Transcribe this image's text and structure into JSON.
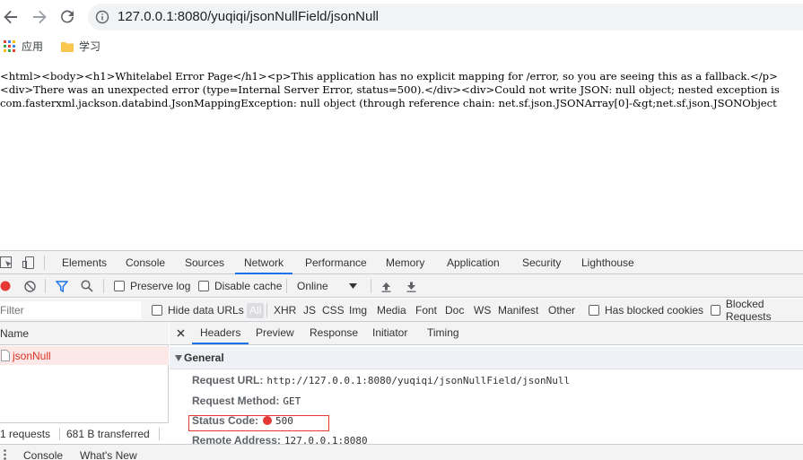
{
  "browser": {
    "url": "127.0.0.1:8080/yuqiqi/jsonNullField/jsonNull",
    "bookmarks": [
      {
        "label": "应用",
        "icon": "apps-grid-icon"
      },
      {
        "label": "学习",
        "icon": "folder-icon"
      }
    ]
  },
  "page": {
    "lines": [
      "<html><body><h1>Whitelabel Error Page</h1><p>This application has no explicit mapping for /error, so you are seeing this as a fallback.</p>",
      "<div>There was an unexpected error (type=Internal Server Error, status=500).</div><div>Could not write JSON: null object; nested exception is",
      "com.fasterxml.jackson.databind.JsonMappingException: null object (through reference chain: net.sf.json.JSONArray[0]-&gt;net.sf.json.JSONObject"
    ]
  },
  "devtools": {
    "tabs": [
      "Elements",
      "Console",
      "Sources",
      "Network",
      "Performance",
      "Memory",
      "Application",
      "Security",
      "Lighthouse"
    ],
    "active_tab": "Network",
    "network_toolbar": {
      "preserve_log": "Preserve log",
      "disable_cache": "Disable cache",
      "throttle": "Online"
    },
    "filter": {
      "placeholder": "Filter",
      "hide_data_urls": "Hide data URLs",
      "types": [
        "All",
        "XHR",
        "JS",
        "CSS",
        "Img",
        "Media",
        "Font",
        "Doc",
        "WS",
        "Manifest",
        "Other"
      ],
      "has_blocked_cookies": "Has blocked cookies",
      "blocked_requests": "Blocked Requests"
    },
    "request_list": {
      "column_name": "Name",
      "rows": [
        {
          "name": "jsonNull",
          "status": "error"
        }
      ],
      "summary_requests": "1 requests",
      "summary_transferred": "681 B transferred"
    },
    "details": {
      "tabs": [
        "Headers",
        "Preview",
        "Response",
        "Initiator",
        "Timing"
      ],
      "active_tab": "Headers",
      "section_title": "General",
      "request_url_key": "Request URL:",
      "request_url": "http://127.0.0.1:8080/yuqiqi/jsonNullField/jsonNull",
      "request_method_key": "Request Method:",
      "request_method": "GET",
      "status_code_key": "Status Code:",
      "status_code": "500",
      "remote_address_key": "Remote Address:",
      "remote_address": "127.0.0.1:8080"
    },
    "drawer_tabs": [
      "Console",
      "What's New"
    ]
  },
  "colors": {
    "accent": "#1a73e8",
    "error": "#d93025",
    "status_red": "#e53935"
  }
}
